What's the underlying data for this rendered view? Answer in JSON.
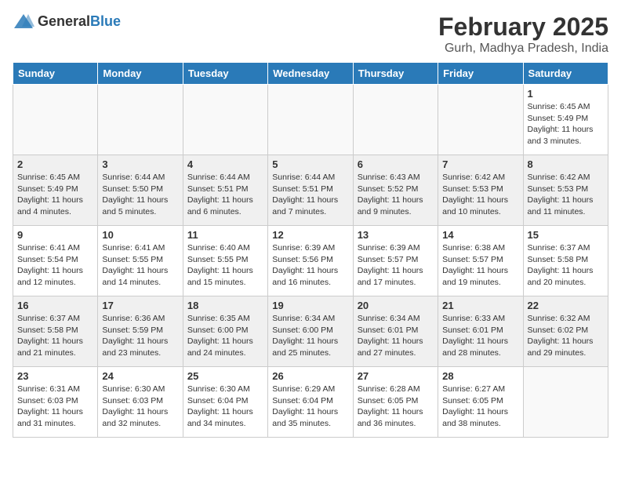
{
  "header": {
    "logo_general": "General",
    "logo_blue": "Blue",
    "month_title": "February 2025",
    "location": "Gurh, Madhya Pradesh, India"
  },
  "days_of_week": [
    "Sunday",
    "Monday",
    "Tuesday",
    "Wednesday",
    "Thursday",
    "Friday",
    "Saturday"
  ],
  "weeks": [
    [
      {
        "day": "",
        "detail": ""
      },
      {
        "day": "",
        "detail": ""
      },
      {
        "day": "",
        "detail": ""
      },
      {
        "day": "",
        "detail": ""
      },
      {
        "day": "",
        "detail": ""
      },
      {
        "day": "",
        "detail": ""
      },
      {
        "day": "1",
        "detail": "Sunrise: 6:45 AM\nSunset: 5:49 PM\nDaylight: 11 hours\nand 3 minutes."
      }
    ],
    [
      {
        "day": "2",
        "detail": "Sunrise: 6:45 AM\nSunset: 5:49 PM\nDaylight: 11 hours\nand 4 minutes."
      },
      {
        "day": "3",
        "detail": "Sunrise: 6:44 AM\nSunset: 5:50 PM\nDaylight: 11 hours\nand 5 minutes."
      },
      {
        "day": "4",
        "detail": "Sunrise: 6:44 AM\nSunset: 5:51 PM\nDaylight: 11 hours\nand 6 minutes."
      },
      {
        "day": "5",
        "detail": "Sunrise: 6:44 AM\nSunset: 5:51 PM\nDaylight: 11 hours\nand 7 minutes."
      },
      {
        "day": "6",
        "detail": "Sunrise: 6:43 AM\nSunset: 5:52 PM\nDaylight: 11 hours\nand 9 minutes."
      },
      {
        "day": "7",
        "detail": "Sunrise: 6:42 AM\nSunset: 5:53 PM\nDaylight: 11 hours\nand 10 minutes."
      },
      {
        "day": "8",
        "detail": "Sunrise: 6:42 AM\nSunset: 5:53 PM\nDaylight: 11 hours\nand 11 minutes."
      }
    ],
    [
      {
        "day": "9",
        "detail": "Sunrise: 6:41 AM\nSunset: 5:54 PM\nDaylight: 11 hours\nand 12 minutes."
      },
      {
        "day": "10",
        "detail": "Sunrise: 6:41 AM\nSunset: 5:55 PM\nDaylight: 11 hours\nand 14 minutes."
      },
      {
        "day": "11",
        "detail": "Sunrise: 6:40 AM\nSunset: 5:55 PM\nDaylight: 11 hours\nand 15 minutes."
      },
      {
        "day": "12",
        "detail": "Sunrise: 6:39 AM\nSunset: 5:56 PM\nDaylight: 11 hours\nand 16 minutes."
      },
      {
        "day": "13",
        "detail": "Sunrise: 6:39 AM\nSunset: 5:57 PM\nDaylight: 11 hours\nand 17 minutes."
      },
      {
        "day": "14",
        "detail": "Sunrise: 6:38 AM\nSunset: 5:57 PM\nDaylight: 11 hours\nand 19 minutes."
      },
      {
        "day": "15",
        "detail": "Sunrise: 6:37 AM\nSunset: 5:58 PM\nDaylight: 11 hours\nand 20 minutes."
      }
    ],
    [
      {
        "day": "16",
        "detail": "Sunrise: 6:37 AM\nSunset: 5:58 PM\nDaylight: 11 hours\nand 21 minutes."
      },
      {
        "day": "17",
        "detail": "Sunrise: 6:36 AM\nSunset: 5:59 PM\nDaylight: 11 hours\nand 23 minutes."
      },
      {
        "day": "18",
        "detail": "Sunrise: 6:35 AM\nSunset: 6:00 PM\nDaylight: 11 hours\nand 24 minutes."
      },
      {
        "day": "19",
        "detail": "Sunrise: 6:34 AM\nSunset: 6:00 PM\nDaylight: 11 hours\nand 25 minutes."
      },
      {
        "day": "20",
        "detail": "Sunrise: 6:34 AM\nSunset: 6:01 PM\nDaylight: 11 hours\nand 27 minutes."
      },
      {
        "day": "21",
        "detail": "Sunrise: 6:33 AM\nSunset: 6:01 PM\nDaylight: 11 hours\nand 28 minutes."
      },
      {
        "day": "22",
        "detail": "Sunrise: 6:32 AM\nSunset: 6:02 PM\nDaylight: 11 hours\nand 29 minutes."
      }
    ],
    [
      {
        "day": "23",
        "detail": "Sunrise: 6:31 AM\nSunset: 6:03 PM\nDaylight: 11 hours\nand 31 minutes."
      },
      {
        "day": "24",
        "detail": "Sunrise: 6:30 AM\nSunset: 6:03 PM\nDaylight: 11 hours\nand 32 minutes."
      },
      {
        "day": "25",
        "detail": "Sunrise: 6:30 AM\nSunset: 6:04 PM\nDaylight: 11 hours\nand 34 minutes."
      },
      {
        "day": "26",
        "detail": "Sunrise: 6:29 AM\nSunset: 6:04 PM\nDaylight: 11 hours\nand 35 minutes."
      },
      {
        "day": "27",
        "detail": "Sunrise: 6:28 AM\nSunset: 6:05 PM\nDaylight: 11 hours\nand 36 minutes."
      },
      {
        "day": "28",
        "detail": "Sunrise: 6:27 AM\nSunset: 6:05 PM\nDaylight: 11 hours\nand 38 minutes."
      },
      {
        "day": "",
        "detail": ""
      }
    ]
  ]
}
